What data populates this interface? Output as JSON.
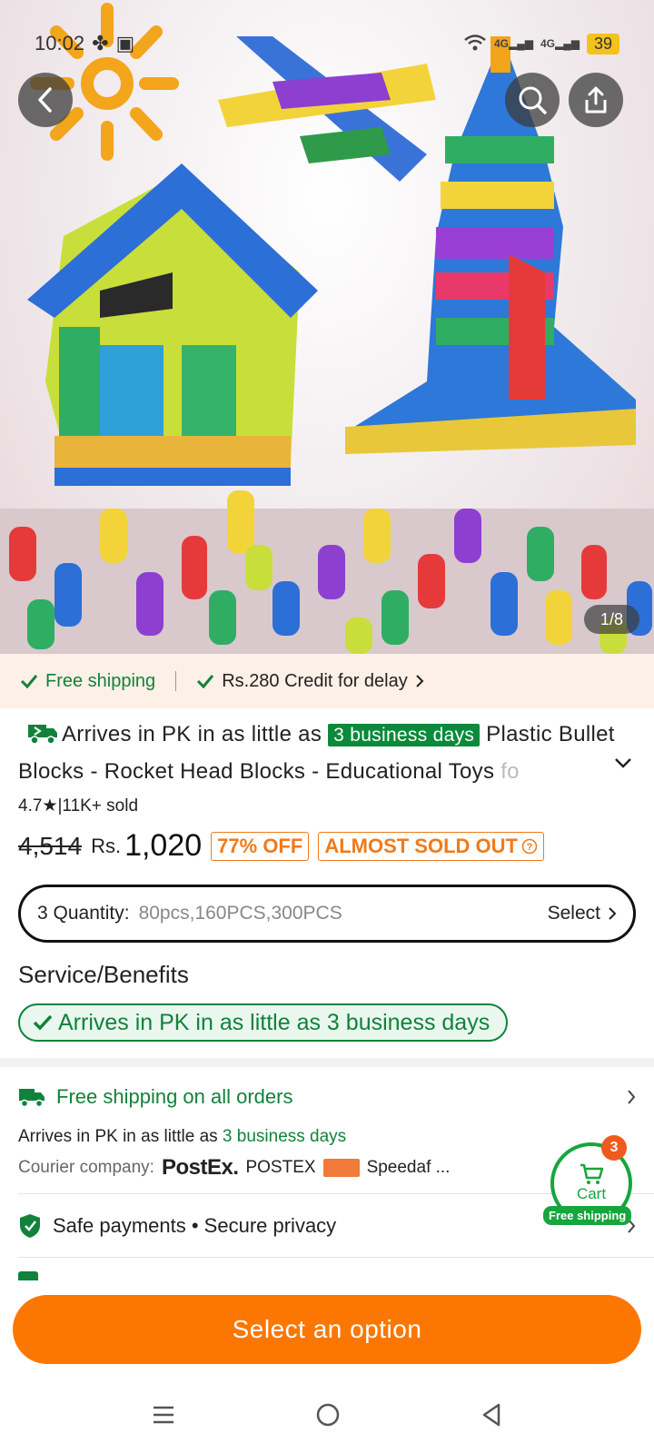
{
  "status_bar": {
    "time": "10:02",
    "network_1": "4G",
    "network_2": "4G",
    "battery": "39"
  },
  "gallery": {
    "counter": "1/8"
  },
  "shipping_strip": {
    "free_shipping": "Free shipping",
    "credit": "Rs.280 Credit for delay"
  },
  "product": {
    "arrives_prefix": "Arrives in PK in as little as",
    "arrives_badge": "3 business days",
    "title_main": "Plastic Bullet Blocks - Rocket Head Blocks - Educational Toys",
    "title_fade": "fo",
    "rating": "4.7",
    "sold": "11K+ sold",
    "old_price": "4,514",
    "currency": "Rs.",
    "price": "1,020",
    "discount": "77% OFF",
    "stock_tag": "ALMOST SOLD OUT"
  },
  "quantity": {
    "label": "3 Quantity:",
    "options": "80pcs,160PCS,300PCS",
    "select": "Select"
  },
  "service": {
    "heading": "Service/Benefits",
    "pill": "Arrives in PK in as little as 3 business days"
  },
  "shipping": {
    "title": "Free shipping on all orders",
    "arrives_prefix": "Arrives in PK in as little as",
    "arrives_days": "3 business days",
    "courier_label": "Courier company:",
    "courier_logo": "PostEx.",
    "courier_1": "POSTEX",
    "courier_2": "Speedaf ..."
  },
  "safe": {
    "label": "Safe payments • Secure privacy"
  },
  "cart": {
    "count": "3",
    "label": "Cart",
    "free": "Free shipping"
  },
  "cta": {
    "label": "Select an option"
  },
  "colors": {
    "accent": "#fb7701",
    "green": "#11823b",
    "badge_green": "#0a8a3a"
  }
}
